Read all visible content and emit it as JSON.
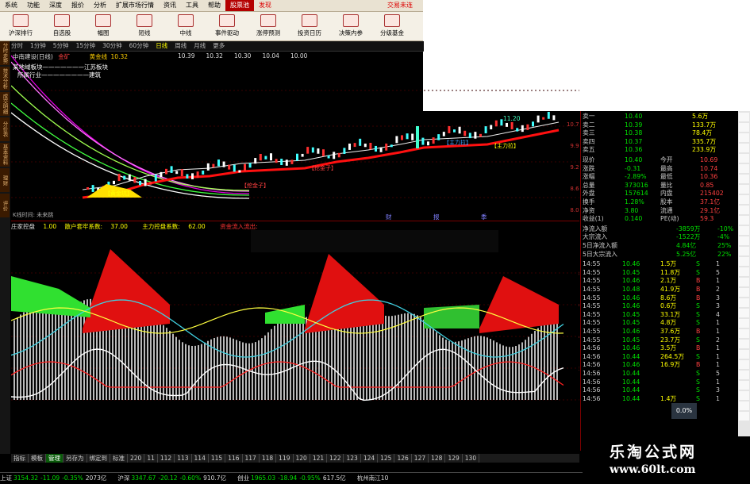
{
  "menu": [
    "系统",
    "功能",
    "深度",
    "报价",
    "分析",
    "扩展市场行情",
    "资讯",
    "工具",
    "帮助"
  ],
  "menu_hi": "股票池",
  "menu_red": "发现",
  "corner_text": "交易未连",
  "toolbar": [
    "沪深排行",
    "自选股",
    "幅图",
    "短线",
    "中线",
    "事件驱动",
    "涨停预测",
    "投资日历",
    "决策内参",
    "分级基金"
  ],
  "sidetabs": [
    "分时走势",
    "技术分析",
    "成交明细",
    "分价表",
    "基本资料",
    "理财",
    "评价"
  ],
  "periods": [
    "分时",
    "1分钟",
    "5分钟",
    "15分钟",
    "30分钟",
    "60分钟",
    "日线",
    "周线",
    "月线",
    "更多"
  ],
  "kline": {
    "title": "中南建设(日线)",
    "tag": "金矿",
    "indicator": "黄金线",
    "indicator_val": "10.32",
    "vals": [
      "10.39",
      "10.32",
      "10.30",
      "10.04",
      "10.00"
    ],
    "legend1": "某地域板块———————江苏板块",
    "legend2": "所属行业————————建筑",
    "peak_label": "11.20",
    "y_ticks": [
      "10.71",
      "9.90",
      "9.29",
      "8.67",
      "8.07",
      "7.46"
    ],
    "labels": [
      "黄金坑",
      "挖金子",
      "挖金子",
      "主力拉",
      "主力拉"
    ],
    "bottom_text": "K线时间: 未来跳",
    "events": [
      "财",
      "报",
      "季"
    ]
  },
  "osc": {
    "name": "庄家控盘",
    "v1": "1.00",
    "f1": "散户套牢系数:",
    "f1v": "37.00",
    "f2": "主力控盘系数:",
    "f2v": "62.00",
    "f3": "资金流入流出:",
    "y_ticks": [
      "80.00",
      "60.00",
      "40.00",
      "20.00",
      "0.00"
    ]
  },
  "quote": {
    "asks": [
      [
        "卖一",
        "10.40",
        "5.6万"
      ],
      [
        "卖二",
        "10.39",
        "133.7万"
      ],
      [
        "卖三",
        "10.38",
        "78.4万"
      ],
      [
        "卖四",
        "10.37",
        "335.7万"
      ],
      [
        "卖五",
        "10.36",
        "233.9万"
      ]
    ],
    "info": [
      [
        "现价",
        "10.40",
        "今开",
        "10.69"
      ],
      [
        "涨跌",
        "-0.31",
        "最高",
        "10.74"
      ],
      [
        "涨幅",
        "-2.89%",
        "最低",
        "10.36"
      ],
      [
        "总量",
        "373016",
        "量比",
        "0.85"
      ],
      [
        "外盘",
        "157614",
        "内盘",
        "215402"
      ],
      [
        "换手",
        "1.28%",
        "股本",
        "37.1亿"
      ],
      [
        "净资",
        "3.80",
        "流通",
        "29.1亿"
      ],
      [
        "收益(1)",
        "0.140",
        "PE(动)",
        "59.3"
      ]
    ],
    "flows": [
      [
        "净流入额",
        "-3859万",
        "-10%"
      ],
      [
        "大宗流入",
        "-1522万",
        "-4%"
      ],
      [
        "5日净流入额",
        "4.84亿",
        "25%"
      ],
      [
        "5日大宗流入",
        "5.25亿",
        "22%"
      ]
    ],
    "ticks": [
      [
        "14:55",
        "10.46",
        "1.5万",
        "S",
        "1"
      ],
      [
        "14:55",
        "10.45",
        "11.8万",
        "S",
        "5"
      ],
      [
        "14:55",
        "10.46",
        "2.1万",
        "B",
        "1"
      ],
      [
        "14:55",
        "10.48",
        "41.9万",
        "B",
        "2"
      ],
      [
        "14:55",
        "10.46",
        "8.6万",
        "B",
        "3"
      ],
      [
        "14:55",
        "10.46",
        "0.6万",
        "S",
        "3"
      ],
      [
        "14:55",
        "10.45",
        "33.1万",
        "S",
        "4"
      ],
      [
        "14:55",
        "10.45",
        "4.8万",
        "S",
        "1"
      ],
      [
        "14:55",
        "10.46",
        "37.6万",
        "B",
        "1"
      ],
      [
        "14:55",
        "10.45",
        "23.7万",
        "S",
        "2"
      ],
      [
        "14:56",
        "10.46",
        "3.5万",
        "B",
        "1"
      ],
      [
        "14:56",
        "10.44",
        "264.5万",
        "S",
        "1"
      ],
      [
        "14:56",
        "10.46",
        "16.9万",
        "B",
        "1"
      ],
      [
        "14:56",
        "10.44",
        "",
        "S",
        "5"
      ],
      [
        "14:56",
        "10.44",
        "",
        "S",
        "1"
      ],
      [
        "14:56",
        "10.44",
        "",
        "S",
        "3"
      ],
      [
        "14:56",
        "10.44",
        "1.4万",
        "S",
        "1"
      ]
    ]
  },
  "badge": "0.0%",
  "bottom_tabs": [
    "指标",
    "模板",
    "管理",
    "另存为",
    "绑定到",
    "标准",
    "220",
    "11",
    "112",
    "113",
    "114",
    "115",
    "116",
    "117",
    "118",
    "119",
    "120",
    "121",
    "122",
    "123",
    "124",
    "125",
    "126",
    "127",
    "128",
    "129",
    "130"
  ],
  "status": [
    [
      "上证",
      "3154.32",
      "-11.09",
      "-0.35%",
      "2073亿"
    ],
    [
      "沪深",
      "3347.67",
      "-20.12",
      "-0.60%",
      "910.7亿"
    ],
    [
      "创业",
      "1965.03",
      "-18.94",
      "-0.95%",
      "617.5亿"
    ]
  ],
  "status_tail": "杭州南江10",
  "watermark": {
    "name": "乐淘公式网",
    "url": "www.60lt.com"
  }
}
